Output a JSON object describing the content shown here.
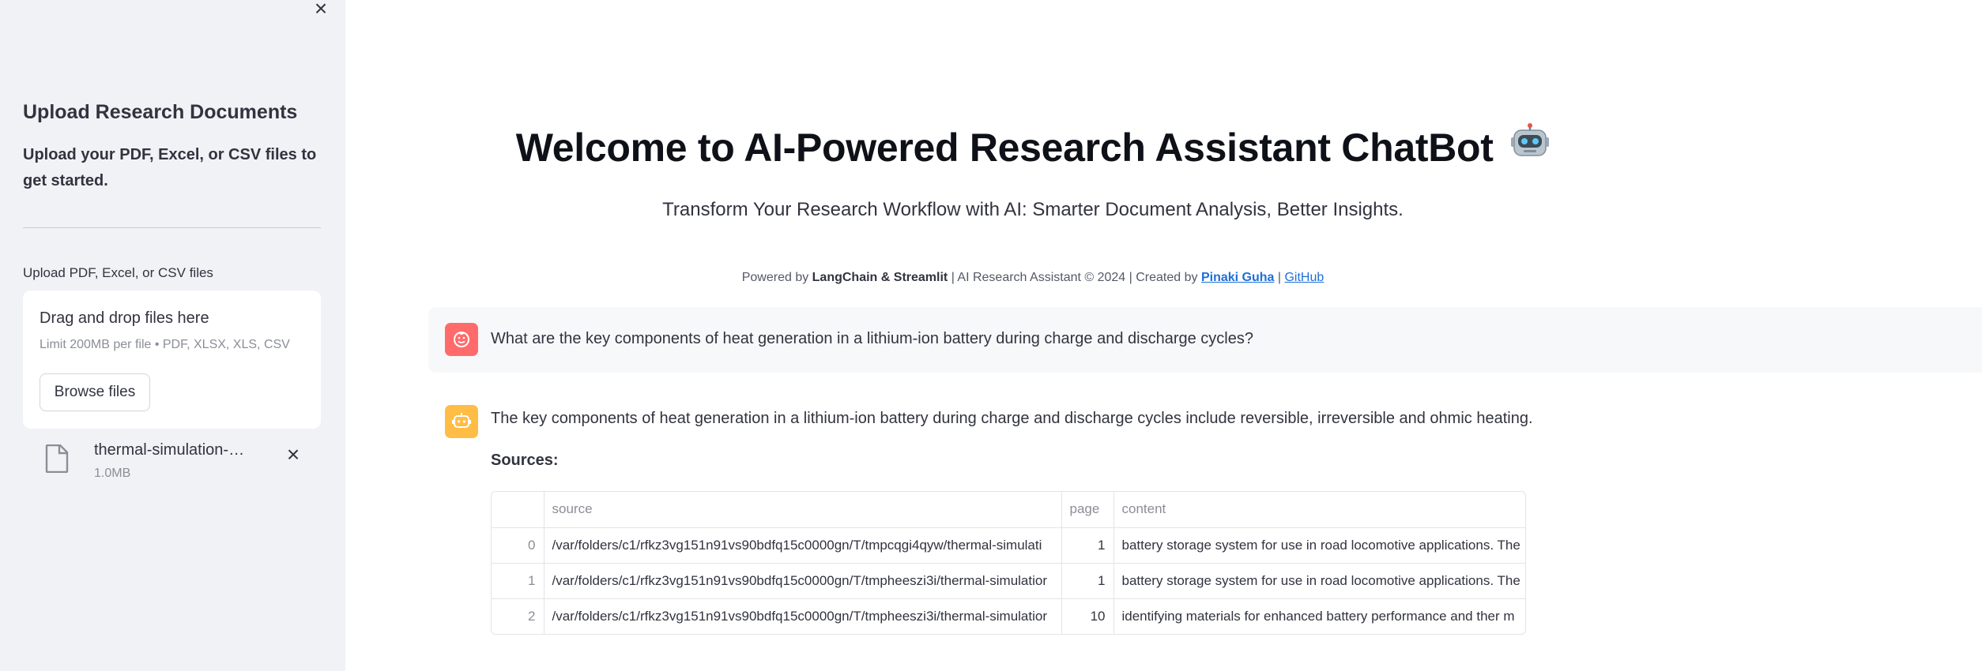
{
  "sidebar": {
    "title": "Upload Research Documents",
    "description": "Upload your PDF, Excel, or CSV files to get started.",
    "uploader_label": "Upload PDF, Excel, or CSV files",
    "dropzone_title": "Drag and drop files here",
    "dropzone_limit": "Limit 200MB per file • PDF, XLSX, XLS, CSV",
    "browse_label": "Browse files",
    "file": {
      "name": "thermal-simulation-analysis.pdf",
      "size": "1.0MB"
    }
  },
  "main": {
    "headline": "Welcome to AI-Powered Research Assistant ChatBot",
    "headline_emoji": "🤖",
    "subtitle": "Transform Your Research Workflow with AI: Smarter Document Analysis, Better Insights.",
    "footer": {
      "powered_prefix": "Powered by ",
      "langchain": "LangChain",
      "amp": " & ",
      "streamlit": "Streamlit",
      "middle": " | AI Research Assistant © 2024 | Created by ",
      "author": "Pinaki Guha",
      "sep": " | ",
      "github": "GitHub"
    },
    "user_message": "What are the key components of heat generation in a lithium-ion battery during charge and discharge cycles?",
    "bot_message": "The key components of heat generation in a lithium-ion battery during charge and discharge cycles include reversible, irreversible and ohmic heating.",
    "sources_label": "Sources:",
    "sources_table": {
      "columns": [
        "",
        "source",
        "page",
        "content"
      ],
      "rows": [
        {
          "index": "0",
          "source": "/var/folders/c1/rfkz3vg151n91vs90bdfq15c0000gn/T/tmpcqgi4qyw/thermal-simulati",
          "page": "1",
          "content": "battery storage system for use in road locomotive applications. The"
        },
        {
          "index": "1",
          "source": "/var/folders/c1/rfkz3vg151n91vs90bdfq15c0000gn/T/tmpheeszi3i/thermal-simulatior",
          "page": "1",
          "content": "battery storage system for use in road locomotive applications. The"
        },
        {
          "index": "2",
          "source": "/var/folders/c1/rfkz3vg151n91vs90bdfq15c0000gn/T/tmpheeszi3i/thermal-simulatior",
          "page": "10",
          "content": "identifying materials for enhanced battery performance and ther m"
        }
      ]
    }
  },
  "icons": {
    "close": "close-icon",
    "file": "file-icon",
    "user_avatar": "user-avatar-icon",
    "bot_avatar": "robot-avatar-icon"
  },
  "colors": {
    "sidebar_bg": "#f0f2f6",
    "user_avatar": "#ff6b6b",
    "bot_avatar": "#ffbd45",
    "link": "#1e6fd9"
  }
}
